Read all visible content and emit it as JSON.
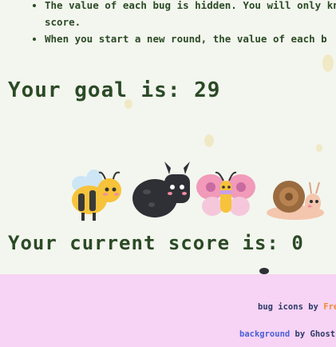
{
  "rules": [
    "The value of each bug is hidden. You will only kn",
    "score.",
    "When you start a new round, the value of each b"
  ],
  "goal_label": "Your goal is:",
  "goal_value": "29",
  "score_label": "Your current score is:",
  "score_value": "0",
  "bugs": [
    {
      "icon": "bee-icon"
    },
    {
      "icon": "beetle-icon"
    },
    {
      "icon": "butterfly-icon"
    },
    {
      "icon": "snail-icon"
    }
  ],
  "credits": {
    "bug_icons_text": "bug icons by",
    "bug_icons_author": "Frei",
    "background_text": "background",
    "background_author": "by Ghost"
  },
  "colors": {
    "text": "#2b4a26",
    "footer_bg": "#f7d3f5",
    "link_orange": "#f08b35",
    "link_blue": "#4960d8"
  }
}
